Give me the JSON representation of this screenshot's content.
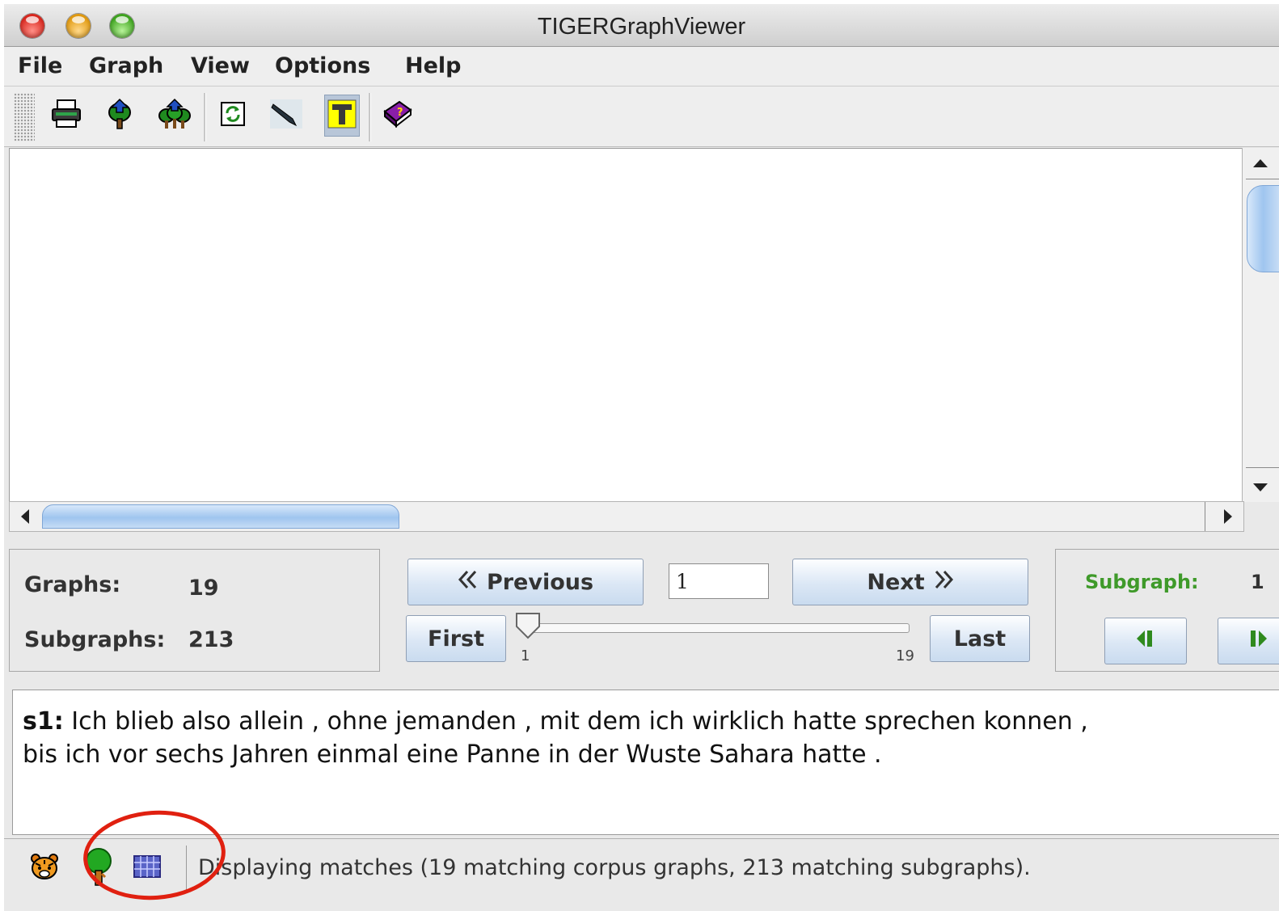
{
  "window": {
    "title": "TIGERGraphViewer"
  },
  "menu": [
    "File",
    "Graph",
    "View",
    "Options",
    "Help"
  ],
  "toolbar": {
    "icons": [
      "printer-icon",
      "tree-export-icon",
      "forest-export-icon",
      "refresh-icon",
      "pen-icon",
      "text-toggle-icon",
      "help-book-icon"
    ],
    "active": "text-toggle-icon"
  },
  "info": {
    "graphs_label": "Graphs:",
    "graphs_value": "19",
    "subgraphs_label": "Subgraphs:",
    "subgraphs_value": "213"
  },
  "navigation": {
    "previous": "Previous",
    "next": "Next",
    "first": "First",
    "last": "Last",
    "current": "1",
    "slider_min": "1",
    "slider_max": "19",
    "slider_value": 1
  },
  "subgraph": {
    "label": "Subgraph:",
    "value": "1"
  },
  "sentence": {
    "id": "s1:",
    "line1": "Ich blieb also allein , ohne jemanden , mit dem ich wirklich hatte sprechen konnen ,",
    "line2": "bis ich vor sechs Jahren einmal eine Panne in der Wuste Sahara hatte ."
  },
  "status": {
    "text": "Displaying matches (19 matching corpus graphs, 213 matching subgraphs).",
    "icons": [
      "tiger-icon",
      "tree-icon",
      "table-icon"
    ]
  },
  "colors": {
    "accent_green": "#3f9a2a",
    "annotation_red": "#e02010"
  }
}
